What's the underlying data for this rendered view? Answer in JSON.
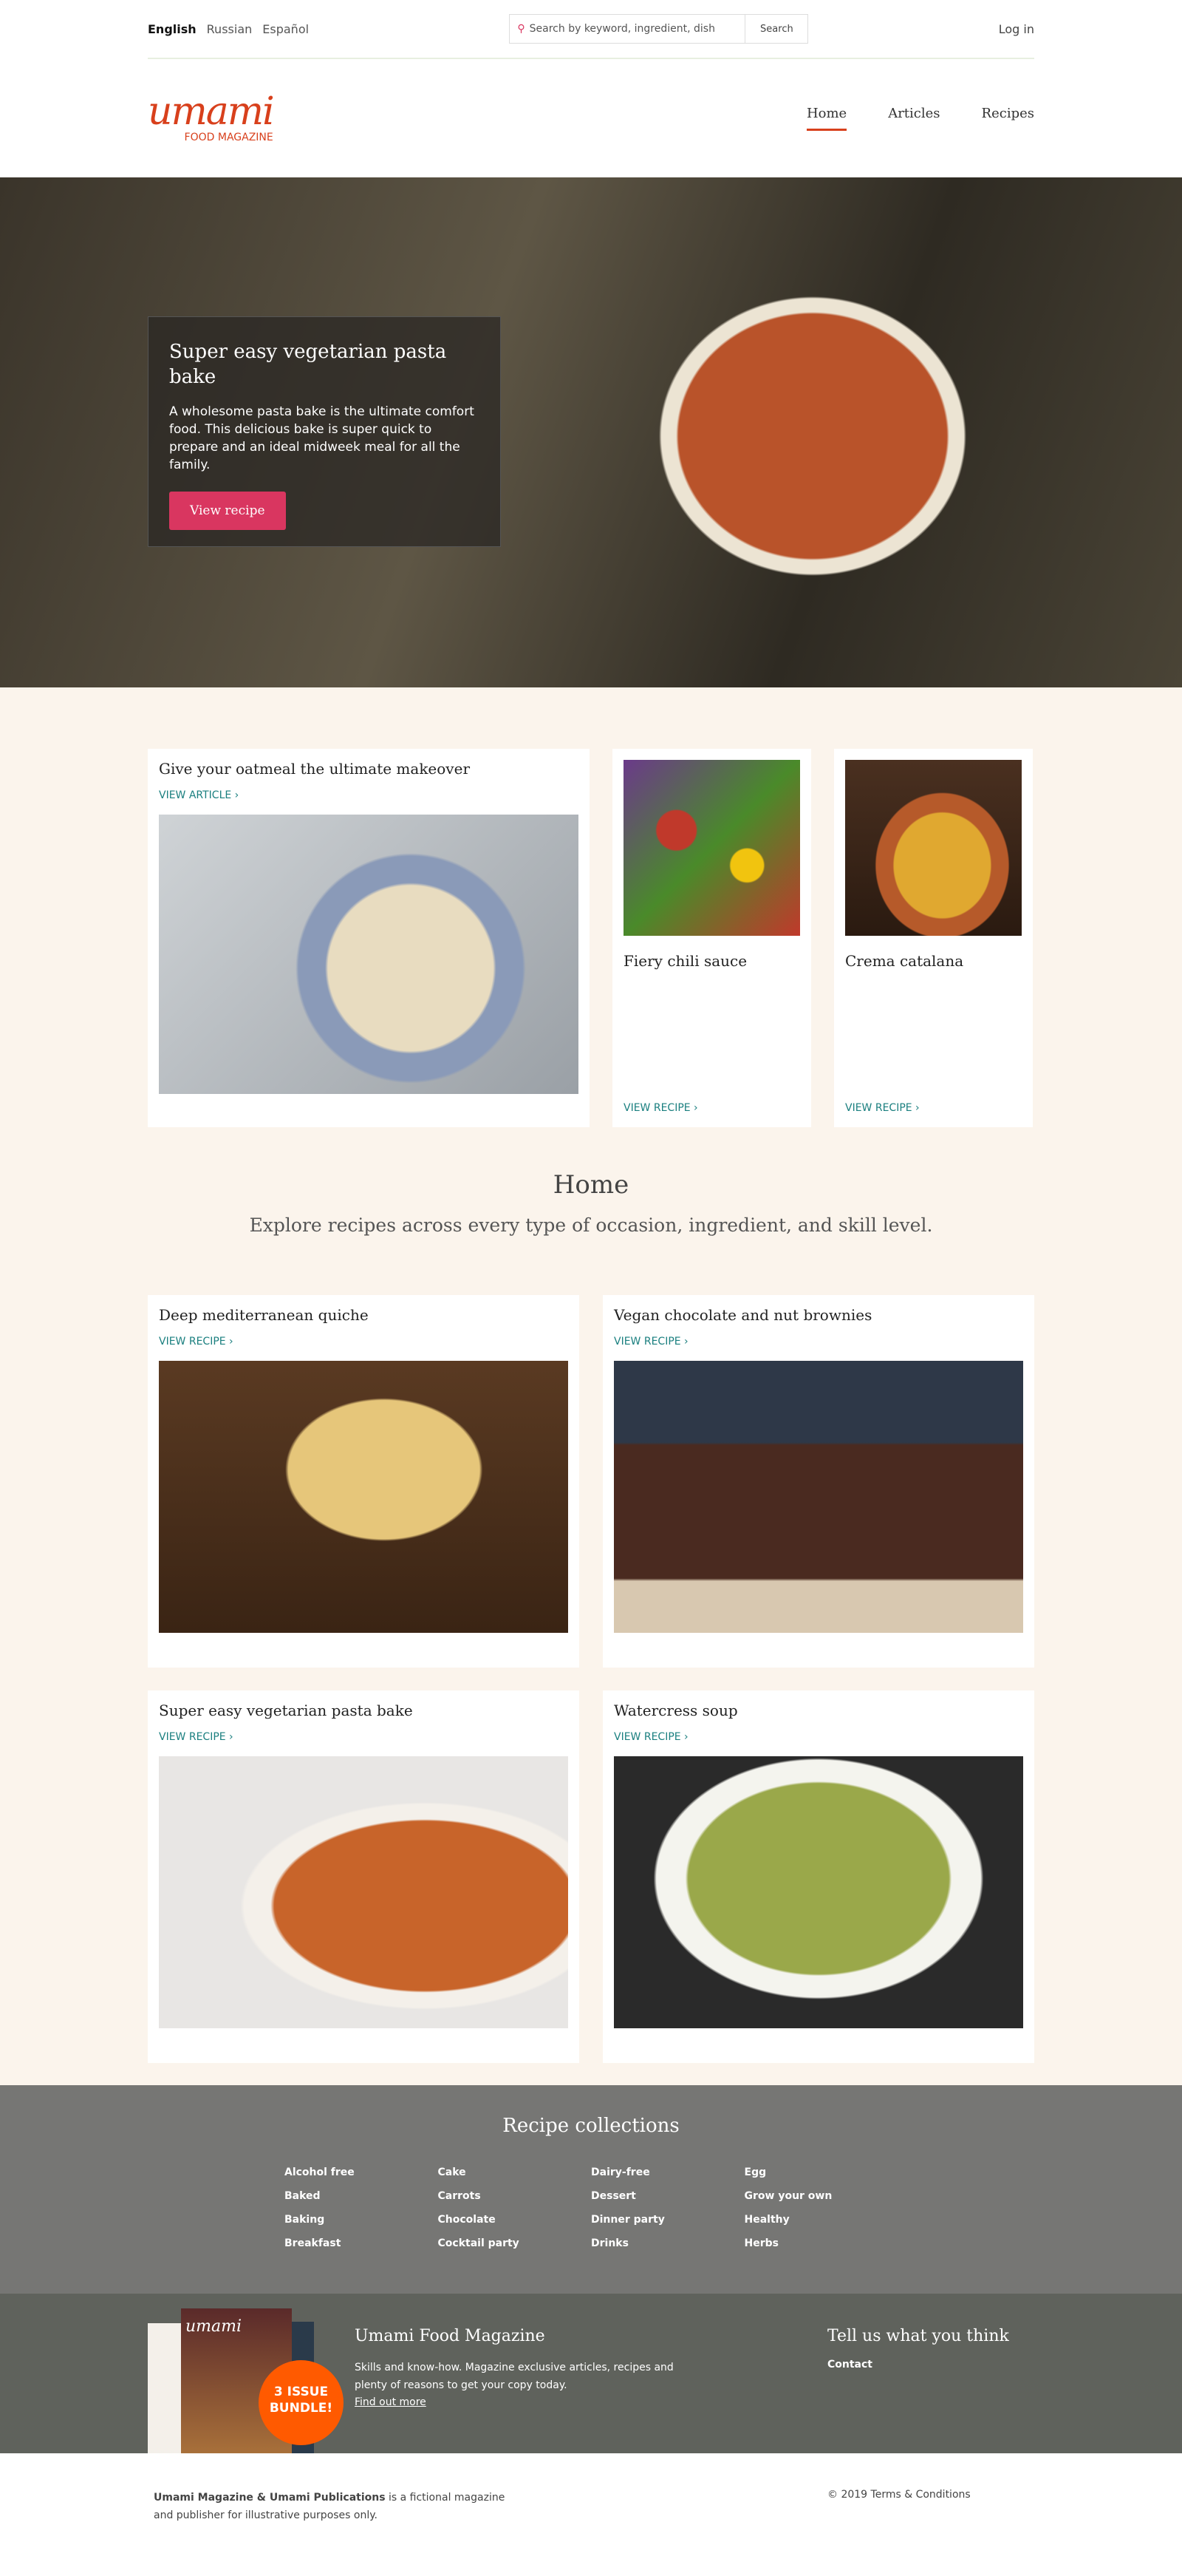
{
  "topbar": {
    "languages": [
      {
        "label": "English",
        "active": true
      },
      {
        "label": "Russian"
      },
      {
        "label": "Español"
      }
    ],
    "search_placeholder": "Search by keyword, ingredient, dish",
    "search_button": "Search",
    "login": "Log in"
  },
  "logo": {
    "word": "umami",
    "sub": "FOOD MAGAZINE"
  },
  "nav": [
    {
      "label": "Home",
      "active": true
    },
    {
      "label": "Articles"
    },
    {
      "label": "Recipes"
    }
  ],
  "hero": {
    "title": "Super easy vegetarian pasta bake",
    "text": "A wholesome pasta bake is the ultimate comfort food. This delicious bake is super quick to prepare and an ideal midweek meal for all the family.",
    "button": "View recipe"
  },
  "featured": {
    "article": {
      "title": "Give your oatmeal the ultimate makeover",
      "link": "VIEW ARTICLE ›"
    },
    "recipes": [
      {
        "title": "Fiery chili sauce",
        "link": "VIEW RECIPE ›"
      },
      {
        "title": "Crema catalana",
        "link": "VIEW RECIPE ›"
      }
    ]
  },
  "intro": {
    "title": "Home",
    "subtitle": "Explore recipes across every type of occasion, ingredient, and skill level."
  },
  "recipes": [
    {
      "title": "Deep mediterranean quiche",
      "link": "VIEW RECIPE ›"
    },
    {
      "title": "Vegan chocolate and nut brownies",
      "link": "VIEW RECIPE ›"
    },
    {
      "title": "Super easy vegetarian pasta bake",
      "link": "VIEW RECIPE ›"
    },
    {
      "title": "Watercress soup",
      "link": "VIEW RECIPE ›"
    }
  ],
  "collections": {
    "title": "Recipe collections",
    "items": [
      "Alcohol free",
      "Cake",
      "Dairy-free",
      "Egg",
      "Baked",
      "Carrots",
      "Dessert",
      "Grow your own",
      "Baking",
      "Chocolate",
      "Dinner party",
      "Healthy",
      "Breakfast",
      "Cocktail party",
      "Drinks",
      "Herbs"
    ]
  },
  "magazine": {
    "title": "Umami Food Magazine",
    "text": "Skills and know-how. Magazine exclusive articles, recipes and plenty of reasons to get your copy today.",
    "link": "Find out more",
    "badge": "3 ISSUE BUNDLE!",
    "feedback_title": "Tell us what you think",
    "contact": "Contact"
  },
  "footer": {
    "bold": "Umami Magazine & Umami Publications",
    "text": " is a fictional magazine and publisher for illustrative purposes only.",
    "copyright": "© 2019 Terms & Conditions"
  }
}
